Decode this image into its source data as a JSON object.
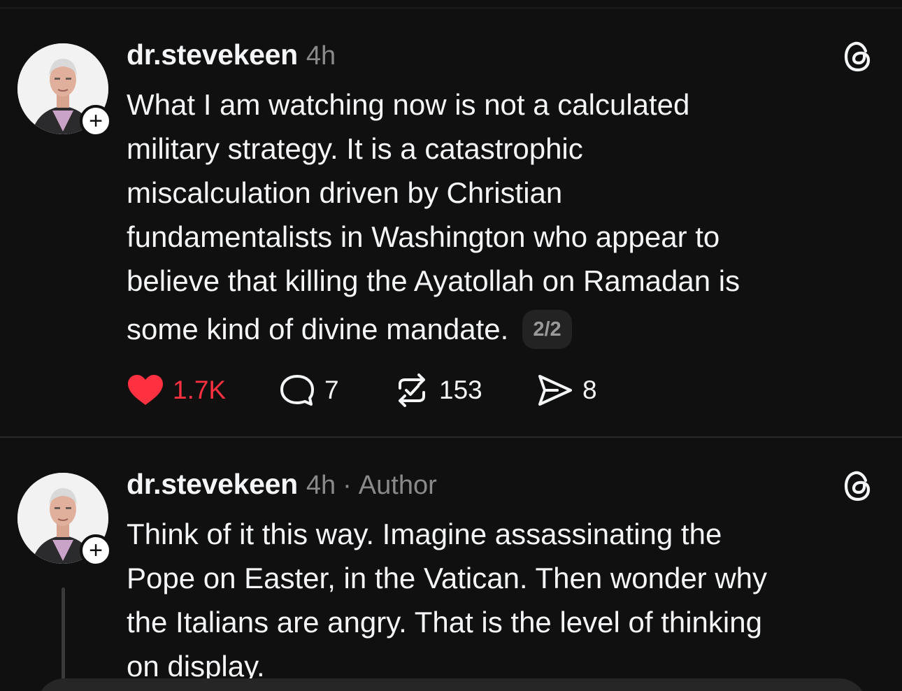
{
  "posts": [
    {
      "username": "dr.stevekeen",
      "time": "4h",
      "author_tag": "",
      "text_lines": [
        "What I am watching now is not a calculated",
        "military strategy. It is a catastrophic",
        "miscalculation driven by Christian",
        "fundamentalists in Washington who appear to",
        "believe that killing the Ayatollah on Ramadan is",
        "some kind of divine mandate."
      ],
      "page_badge": "2/2",
      "actions": {
        "likes": "1.7K",
        "replies": "7",
        "reposts": "153",
        "shares": "8"
      }
    },
    {
      "username": "dr.stevekeen",
      "time": "4h",
      "separator": "·",
      "author_tag": "Author",
      "text_lines": [
        "Think of it this way. Imagine assassinating the",
        "Pope on Easter, in the Vatican. Then wonder why",
        "the Italians are angry. That is the level of thinking",
        "on display."
      ]
    }
  ],
  "icons": {
    "threads": "threads-logo-icon",
    "like": "heart-icon",
    "reply": "speech-bubble-icon",
    "repost": "repost-icon",
    "share": "paper-plane-icon",
    "follow": "plus-icon"
  },
  "colors": {
    "background": "#101010",
    "text": "#f3f5f7",
    "muted": "#8a8a8a",
    "like_active": "#ff3040"
  }
}
